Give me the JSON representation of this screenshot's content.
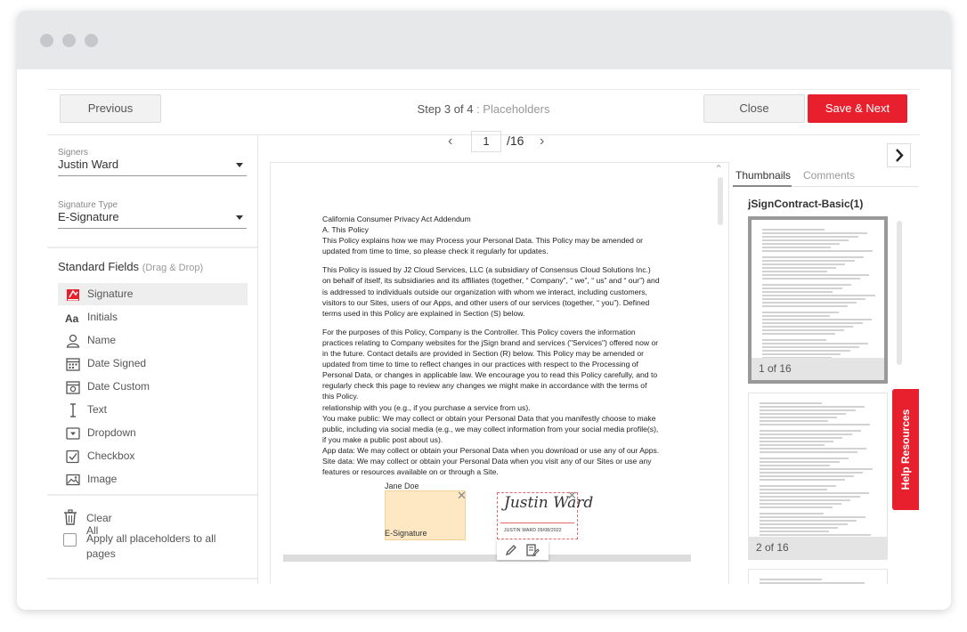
{
  "toolbar": {
    "previous_label": "Previous",
    "step_label": "Step 3 of 4",
    "step_sub": "Placeholders",
    "close_label": "Close",
    "save_next_label": "Save & Next"
  },
  "left_panel": {
    "signers_label": "Signers",
    "signer_value": "Justin Ward",
    "signature_type_label": "Signature Type",
    "signature_type_value": "E-Signature",
    "standard_fields_title": "Standard Fields",
    "standard_fields_hint": "(Drag & Drop)",
    "fields": [
      {
        "label": "Signature",
        "icon": "signature-icon"
      },
      {
        "label": "Initials",
        "icon": "initials-icon"
      },
      {
        "label": "Name",
        "icon": "user-icon"
      },
      {
        "label": "Date Signed",
        "icon": "calendar-icon"
      },
      {
        "label": "Date Custom",
        "icon": "calendar-gear-icon"
      },
      {
        "label": "Text",
        "icon": "text-cursor-icon"
      },
      {
        "label": "Dropdown",
        "icon": "dropdown-icon"
      },
      {
        "label": "Checkbox",
        "icon": "checkbox-icon"
      },
      {
        "label": "Image",
        "icon": "image-icon"
      }
    ],
    "clear_all_label": "Clear All",
    "apply_all_label": "Apply all placeholders to all pages"
  },
  "pager": {
    "current_page": "1",
    "total": "/16"
  },
  "document": {
    "paragraphs": [
      "California Consumer Privacy Act Addendum",
      "A. This Policy",
      "This Policy explains how we may Process your Personal Data. This Policy may be amended or updated from time to time, so please check it regularly for updates.",
      "This Policy is issued by J2 Cloud Services, LLC (a subsidiary of Consensus Cloud Solutions Inc.) on behalf of itself, its subsidiaries and its affiliates (together, “ Company”, “ we”, “ us” and “ our”) and is addressed to individuals outside our organization with whom we interact, including customers, visitors to our Sites, users of our Apps, and other users of our services (together, “ you”). Defined terms used in this Policy are explained in Section (S) below.",
      "For the purposes of this Policy, Company is the Controller. This Policy covers the information practices relating to Company websites for the jSign brand and services (\"Services\") offered now or in the future. Contact details are provided in Section (R) below. This Policy may be amended or updated from time to time to reflect changes in our practices with respect to the Processing of Personal Data, or changes in applicable law. We encourage you to read this Policy carefully, and to regularly check this page to review any changes we might make in accordance with the terms of this Policy.",
      "relationship with you (e.g., if you purchase a service from us).",
      "You make public: We may collect or obtain your Personal Data that you manifestly choose to make public, including via social media (e.g., we may collect information from your social media profile(s), if you make a public post about us).",
      "App data: We may collect or obtain your Personal Data when you download or use any of our Apps.",
      "Site data: We may collect or obtain your Personal Data when you visit any of our Sites or use any features or resources available on or through a Site."
    ],
    "placeholder_initials": {
      "signer": "Jane Doe",
      "type": "E-Signature"
    },
    "placeholder_signature": {
      "signature_text": "Justin Ward",
      "meta_text": "JUSTIN WARD  09/08/2022"
    }
  },
  "right_panel": {
    "tab_thumbnails": "Thumbnails",
    "tab_comments": "Comments",
    "doc_name": "jSignContract-Basic(1)",
    "thumbnails": [
      {
        "label": "1 of 16"
      },
      {
        "label": "2 of 16"
      }
    ]
  },
  "help_label": "Help Resources",
  "colors": {
    "accent": "#e8202e",
    "initials_fill": "#fde8c3",
    "signature_border": "#e06a6a"
  }
}
